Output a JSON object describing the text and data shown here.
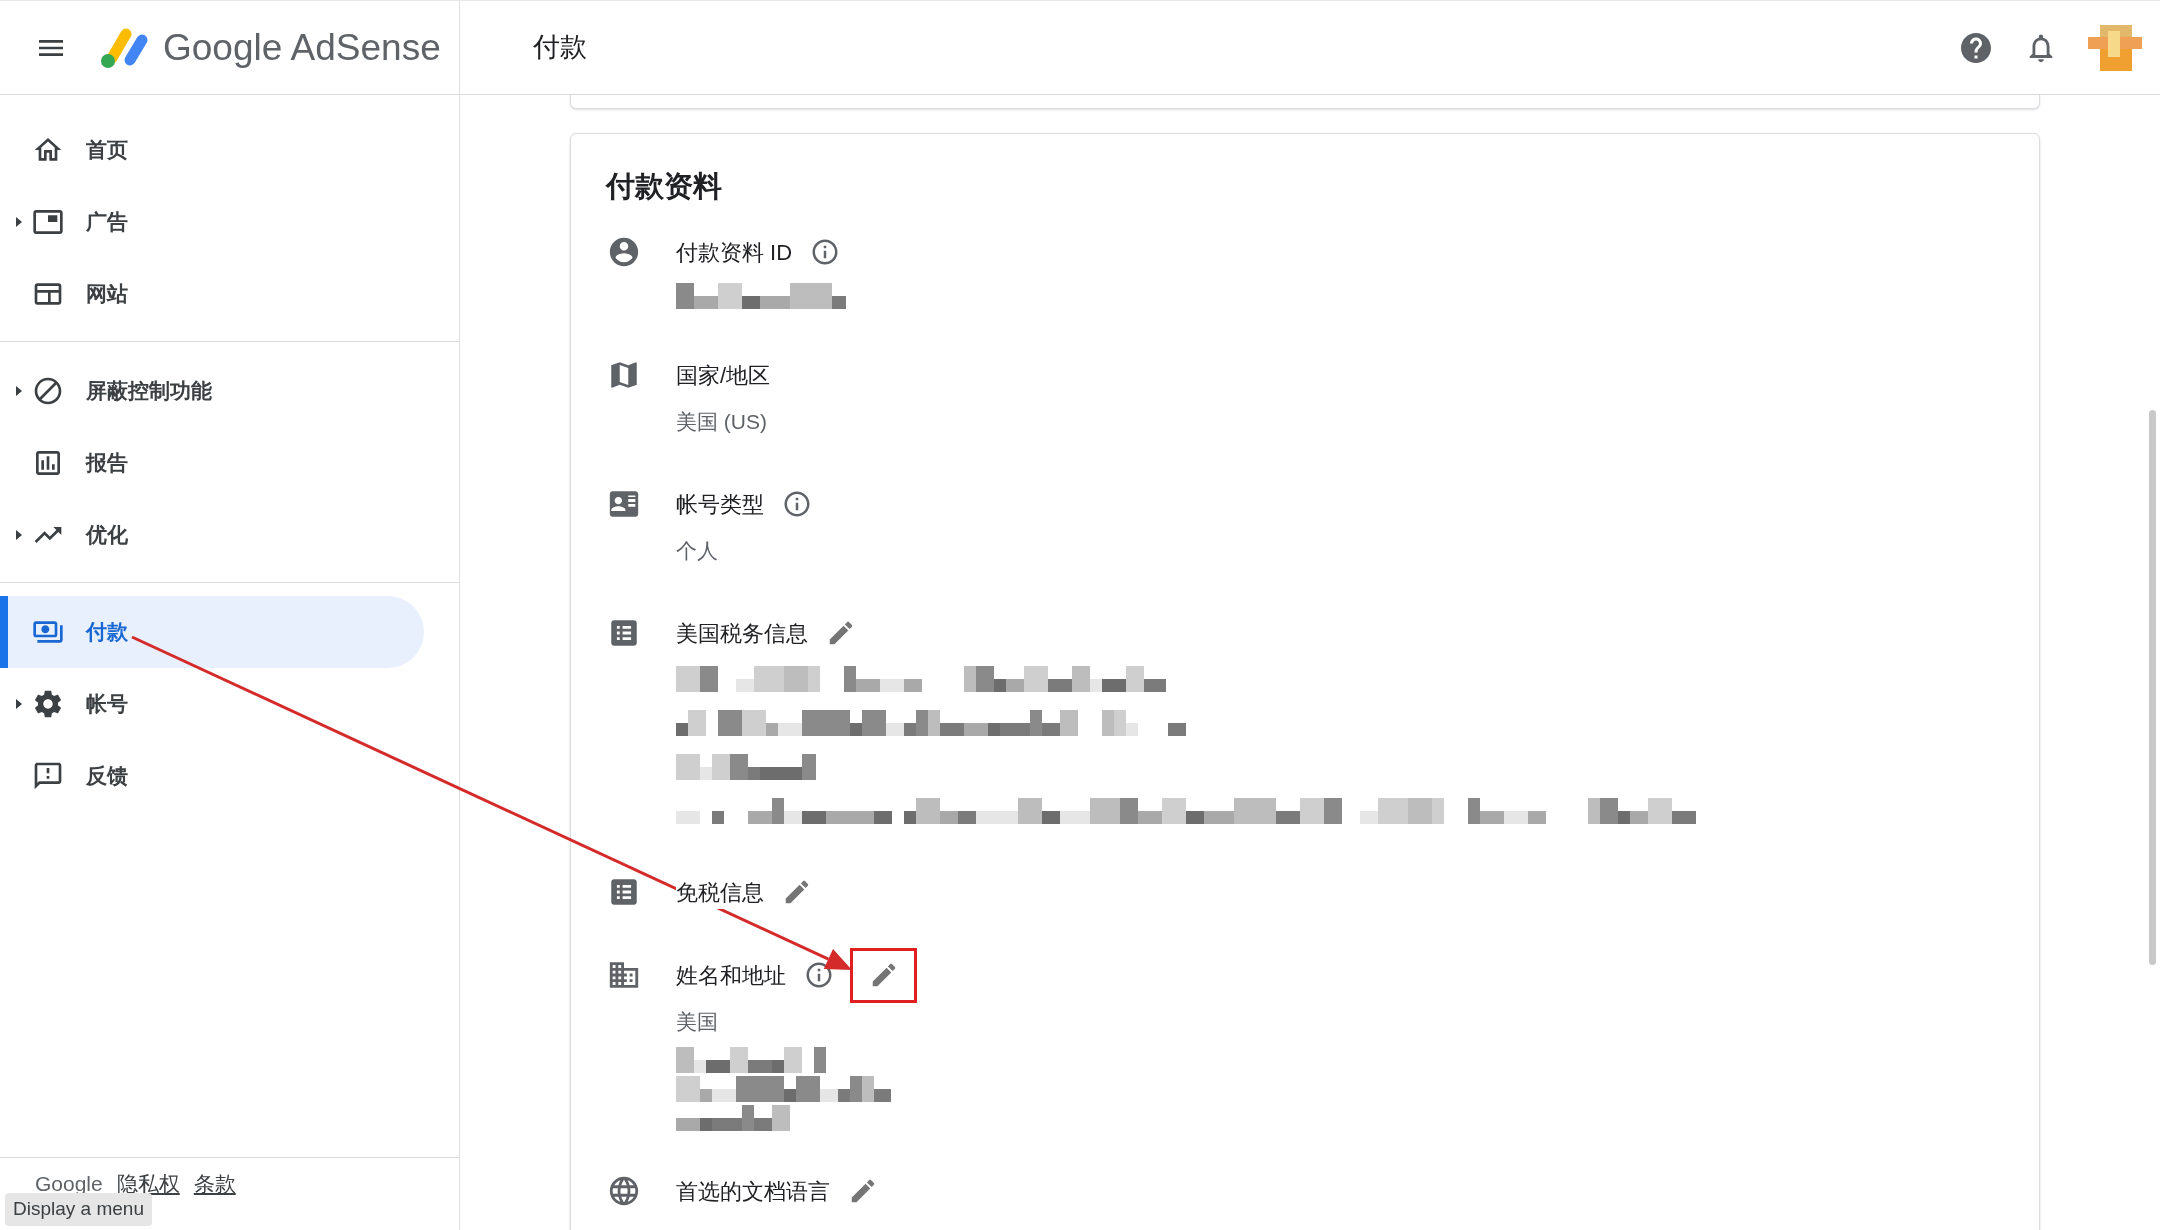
{
  "header": {
    "logo_text": "Google AdSense",
    "page_title": "付款"
  },
  "sidebar": {
    "groups": [
      [
        {
          "kind": "home",
          "label": "首页",
          "expandable": false,
          "selected": false
        },
        {
          "kind": "ad",
          "label": "广告",
          "expandable": true,
          "expanded": false,
          "selected": false
        },
        {
          "kind": "site",
          "label": "网站",
          "expandable": false,
          "selected": false
        }
      ],
      [
        {
          "kind": "block",
          "label": "屏蔽控制功能",
          "expandable": true,
          "expanded": false,
          "selected": false
        },
        {
          "kind": "report",
          "label": "报告",
          "expandable": false,
          "selected": false
        },
        {
          "kind": "trend",
          "label": "优化",
          "expandable": true,
          "expanded": false,
          "selected": false
        }
      ],
      [
        {
          "kind": "payments",
          "label": "付款",
          "expandable": false,
          "selected": true
        },
        {
          "kind": "gear",
          "label": "帐号",
          "expandable": true,
          "expanded": false,
          "selected": false
        },
        {
          "kind": "feedback",
          "label": "反馈",
          "expandable": false,
          "selected": false
        }
      ]
    ],
    "footer_links": [
      "Google",
      "隐私权",
      "条款"
    ]
  },
  "tooltip": "Display a menu",
  "card": {
    "title": "付款资料",
    "fields": [
      {
        "kind": "person",
        "label": "付款资料 ID",
        "info": true,
        "editable": false,
        "values": [
          {
            "kind": "redacted"
          }
        ]
      },
      {
        "kind": "map",
        "label": "国家/地区",
        "info": false,
        "editable": false,
        "values": [
          {
            "kind": "text",
            "text": "美国 (US)"
          }
        ]
      },
      {
        "kind": "card",
        "label": "帐号类型",
        "info": true,
        "editable": false,
        "values": [
          {
            "kind": "text",
            "text": "个人"
          }
        ]
      },
      {
        "kind": "list",
        "label": "美国税务信息",
        "info": false,
        "editable": true,
        "values": [
          {
            "kind": "redacted"
          },
          {
            "kind": "redacted"
          },
          {
            "kind": "redacted"
          },
          {
            "kind": "redacted"
          }
        ]
      },
      {
        "kind": "list",
        "label": "免税信息",
        "info": false,
        "editable": true
      },
      {
        "kind": "building",
        "label": "姓名和地址",
        "info": true,
        "editable": true,
        "highlighted": true,
        "values": [
          {
            "kind": "text",
            "text": "美国"
          },
          {
            "kind": "redacted"
          },
          {
            "kind": "redacted"
          },
          {
            "kind": "redacted"
          }
        ]
      },
      {
        "kind": "globe",
        "label": "首选的文档语言",
        "info": false,
        "editable": true
      }
    ]
  },
  "annotations": [
    {
      "kind": "arrow"
    }
  ]
}
